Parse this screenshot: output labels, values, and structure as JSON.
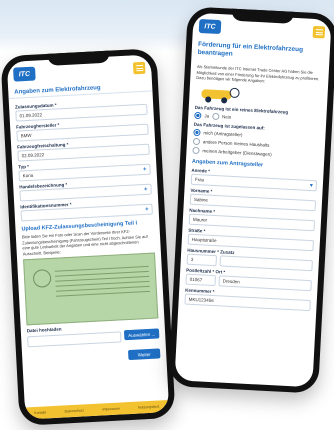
{
  "left": {
    "logo": "ITC",
    "title": "Angaben zum Elektrofahrzeug",
    "fields": [
      {
        "label": "Zulassungsdatum *",
        "value": "01.09.2022"
      },
      {
        "label": "Fahrzeughersteller *",
        "value": "BMW"
      },
      {
        "label": "Fahrzeugfreischaltung *",
        "value": "02.09.2022"
      },
      {
        "label": "Typ *",
        "value": "Kona"
      },
      {
        "label": "Handelsbezeichnung *",
        "value": ""
      },
      {
        "label": "Identifikationsnummer *",
        "value": ""
      }
    ],
    "upload_title": "Upload KFZ-Zulassungsbescheinigung Teil I",
    "upload_note": "Bitte laden Sie ein Foto oder Scan der Vorderseite Ihrer KFZ-Zulassungsbescheinigung (Fahrzeugschein) Teil I hoch. Achten Sie auf eine gute Lesbarkeit der Angaben und eine nicht abgeschnittenen Ausschnitt. Beispiele:",
    "file_label": "Datei hochladen",
    "file_button": "Auswählen ...",
    "next_button": "Weiter",
    "footer": [
      "Kontakt",
      "Datenschutz",
      "Impressum",
      "Nutzungsbed."
    ]
  },
  "right": {
    "logo": "ITC",
    "title": "Förderung für ein Elektrofahrzeug beantragen",
    "intro": "Als Stammkunde der ITC Internet Trade Center AG haben Sie die Möglichkeit von einer Förderung für ihr Elektrofahrzeug zu profitieren. Dazu benötigen wir folgende Angaben:",
    "q1": "Das Fahrzeug ist ein reines Elektrofahrzeug",
    "q1_opts": [
      "Ja",
      "Nein"
    ],
    "q2": "Das Fahrzeug ist zugelassen auf:",
    "q2_opts": [
      "mich (Antragsteller)",
      "andere Person meines Haushalts",
      "meinen Arbeitgeber (Dienstwagen)"
    ],
    "section": "Angaben zum Antragsteller",
    "fields": [
      {
        "label": "Anrede *",
        "value": "Frau"
      },
      {
        "label": "Vorname *",
        "value": "Sabine"
      },
      {
        "label": "Nachname *",
        "value": "Maurer"
      },
      {
        "label": "Straße *",
        "value": "Hauptstraße"
      },
      {
        "label": "Hausnummer * Zusatz",
        "value": "3"
      },
      {
        "label": "Postleitzahl * Ort *",
        "value": "01067",
        "value2": "Dresden"
      },
      {
        "label": "Kennummer *",
        "value": "MKU123456"
      }
    ]
  }
}
